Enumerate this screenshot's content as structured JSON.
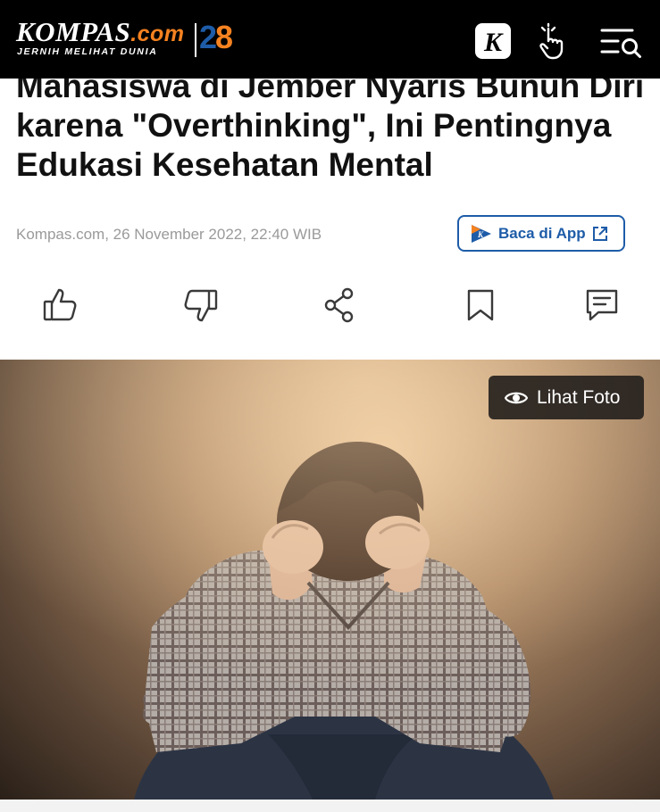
{
  "header": {
    "logo_main": "KOMPAS",
    "logo_dotcom": ".com",
    "logo_tagline": "JERNIH MELIHAT DUNIA",
    "anniversary_a": "2",
    "anniversary_b": "8",
    "k_icon_letter": "K"
  },
  "article": {
    "headline": "Mahasiswa di Jember Nyaris Bunuh Diri karena \"Overthinking\", Ini Pentingnya Edukasi Kesehatan Mental",
    "meta": "Kompas.com, 26 November 2022, 22:40 WIB",
    "app_button_label": "Baca di App",
    "photo_button_label": "Lihat Foto"
  },
  "colors": {
    "topbar": "#000000",
    "brand_blue": "#1e5ca8",
    "brand_orange": "#f58220"
  }
}
